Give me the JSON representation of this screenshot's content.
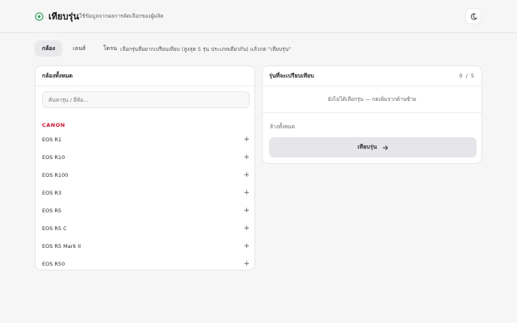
{
  "header": {
    "title": "เทียบรุ่น",
    "subtitle": "ใช้ข้อมูลจากผลการคัดเลือกของผู้ผลิต",
    "logo_icon": "compare-logo-icon",
    "theme_icon": "moon-icon"
  },
  "tabs": [
    {
      "label": "กล้อง",
      "active": true
    },
    {
      "label": "เลนส์",
      "active": false
    },
    {
      "label": "โดรน",
      "active": false
    }
  ],
  "hint": "เลือกรุ่นที่อยากเปรียบเทียบ (สูงสุด 5 รุ่น ประเภทเดียวกัน) แล้วกด \"เทียบรุ่น\"",
  "left_panel": {
    "title": "กล้องทั้งหมด",
    "search_placeholder": "ค้นหารุ่น / ยี่ห้อ...",
    "brand": "CANON",
    "models": [
      "EOS R1",
      "EOS R10",
      "EOS R100",
      "EOS R3",
      "EOS R5",
      "EOS R5 C",
      "EOS R5 Mark II",
      "EOS R50"
    ],
    "add_symbol": "+"
  },
  "right_panel": {
    "title": "รุ่นที่จะเปรียบเทียบ",
    "counter": "0 / 5",
    "empty_message": "ยังไม่ได้เลือกรุ่น — กดเพิ่มจากด้านซ้าย",
    "clear_label": "ล้างทั้งหมด",
    "compare_label": "เทียบรุ่น",
    "compare_icon": "arrow-right-icon"
  },
  "colors": {
    "brand_red": "#c8102e",
    "logo_green": "#2f9e5a",
    "active_tab": "#e9e9ec"
  }
}
